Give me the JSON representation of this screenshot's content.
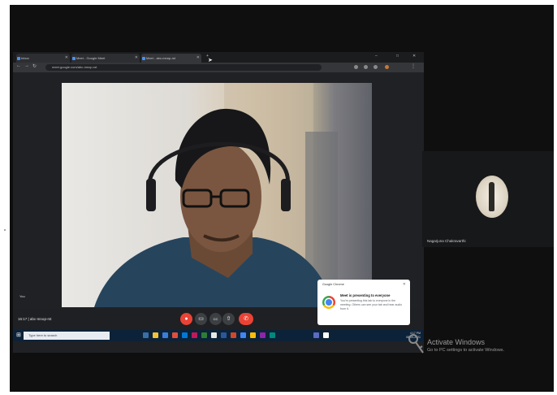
{
  "browser": {
    "tabs": [
      {
        "label": "Inbox"
      },
      {
        "label": "Meet - Google Meet"
      },
      {
        "label": "Meet - abc-mnop-rst"
      }
    ],
    "url": "meet.google.com/abc-mnop-rst",
    "win_controls": [
      "–",
      "□",
      "✕"
    ]
  },
  "meeting": {
    "remote_tile_name": "You",
    "meeting_code": "16:17 | abc-mnop-rst",
    "controls": [
      {
        "name": "mic",
        "glyph": "🎤"
      },
      {
        "name": "camera",
        "glyph": "▭"
      },
      {
        "name": "captions",
        "glyph": "CC"
      },
      {
        "name": "present",
        "glyph": "⇧"
      },
      {
        "name": "more",
        "glyph": "⋮"
      },
      {
        "name": "end-call",
        "glyph": "✆"
      }
    ]
  },
  "notification": {
    "app": "Google Chrome",
    "title": "Meet is presenting to everyone",
    "body": "You're presenting this tab to everyone in the meeting. Others can see your tab and hear audio from it.",
    "close": "✕"
  },
  "taskbar": {
    "start_glyph": "⊞",
    "search_placeholder": "Type here to search",
    "tray_time": "4:17 PM",
    "tray_date": "08-09-2021"
  },
  "participant": {
    "name": "Nagarjuna Chakravarthi"
  },
  "watermark": {
    "title": "Activate Windows",
    "subtitle": "Go to PC settings to activate Windows."
  },
  "colors": {
    "end_call": "#ea4335",
    "taskbar": "#0c2238",
    "meet_bg": "#202124"
  }
}
